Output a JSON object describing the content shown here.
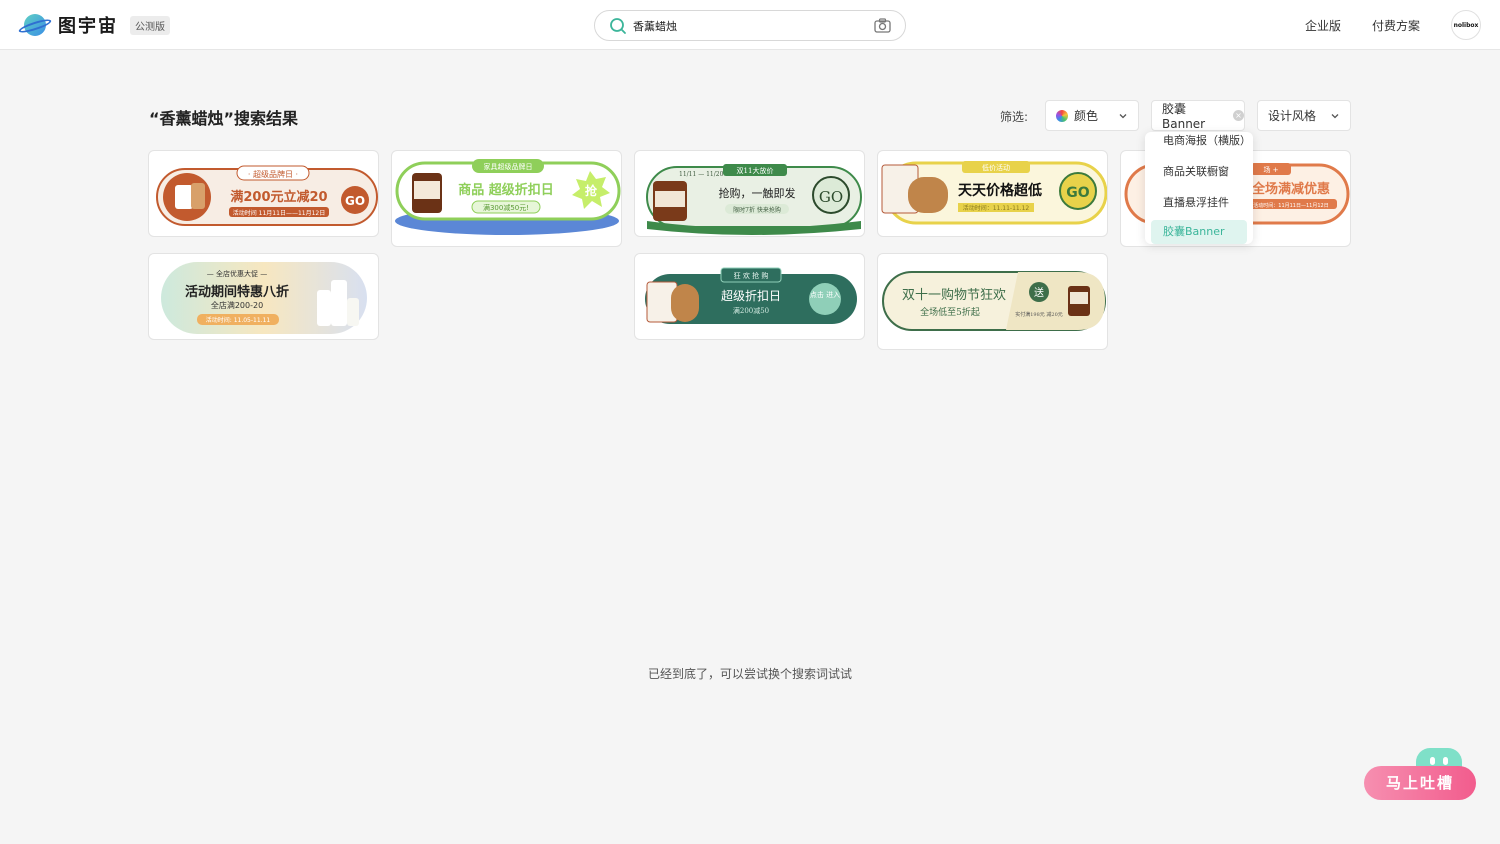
{
  "header": {
    "logo_text": "图宇宙",
    "beta_badge": "公测版",
    "search_value": "香薰蜡烛",
    "nav": [
      "企业版",
      "付费方案"
    ],
    "avatar_text": "nolibox"
  },
  "results": {
    "title": "“香薰蜡烛”搜索结果"
  },
  "filters": {
    "label": "筛选:",
    "color": "颜色",
    "banner": "胶囊Banner",
    "style": "设计风格"
  },
  "dropdown": {
    "items": [
      "电商海报（横版）",
      "商品关联橱窗",
      "直播悬浮挂件",
      "胶囊Banner"
    ],
    "active": "胶囊Banner"
  },
  "cards": [
    {
      "tag": "· 超级品牌日 ·",
      "headline": "满200元立减20",
      "btn": "GO",
      "sub": "活动时间  11月11日——11月12日",
      "accent": "#c25a2e"
    },
    {
      "tag": "家具超级品牌日",
      "headline": "商品 超级折扣日",
      "btn": "抢",
      "sub": "满300减50元!",
      "accent": "#8fcf5a"
    },
    {
      "tag": "双11大放价",
      "date": "11/11 — 11/20",
      "headline": "抢购，一触即发",
      "btn": "GO",
      "sub": "限时7折 快来抢购",
      "accent": "#3e8a4a"
    },
    {
      "tag": "低价活动",
      "headline": "天天价格超低",
      "btn": "GO",
      "sub": "活动时间：11.11-11.12",
      "accent": "#e8d24a"
    },
    {
      "tag": "场 +",
      "headline": "全场满减优惠",
      "sub": "活动时间：11月11日—11月12日",
      "accent": "#e07a4a"
    },
    {
      "tag": "— 全店优惠大促 —",
      "headline": "活动期间特惠八折",
      "line2": "全店满200-20",
      "sub": "活动时间: 11.05-11.11",
      "accent": "#f0b060"
    },
    {
      "tag": "狂 欢 抢 购",
      "headline": "超级折扣日",
      "btn": "点击\n进入",
      "sub": "满200减50",
      "accent": "#2e6e5e"
    },
    {
      "headline": "双十一购物节狂欢",
      "line2": "全场低至5折起",
      "btn": "送",
      "sub": "实付满198元 减20元",
      "accent": "#3e6e4a"
    }
  ],
  "footer": {
    "end_text": "已经到底了，可以尝试换个搜索词试试",
    "feedback": "马上吐槽"
  },
  "colors": {
    "accent": "#3bb59a"
  }
}
